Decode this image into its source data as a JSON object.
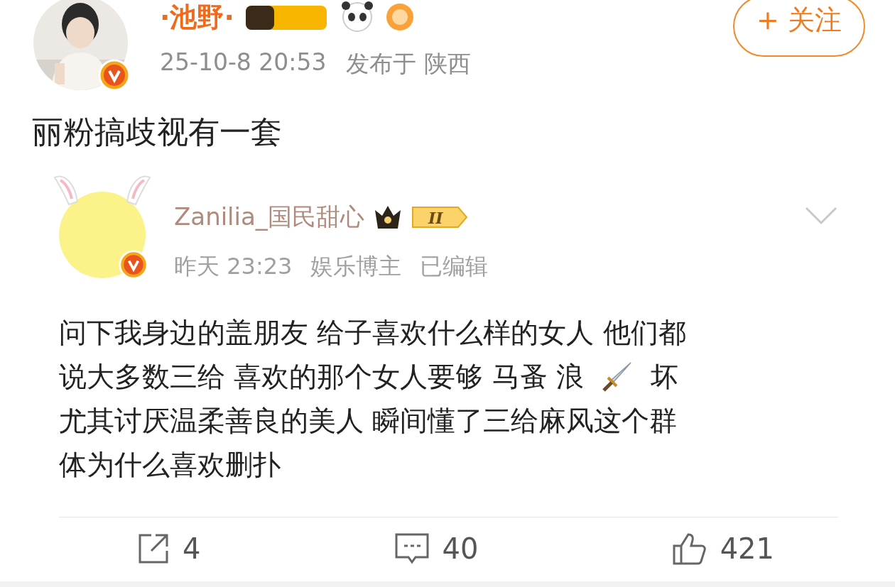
{
  "post": {
    "author": "·池野·",
    "time": "25-10-8 20:53",
    "location": "发布于 陕西",
    "follow_label": "+ 关注",
    "text": "丽粉搞歧视有一套"
  },
  "quoted": {
    "author": "Zanilia_国民甜心",
    "level": "II",
    "meta": [
      "昨天 23:23",
      "娱乐博主",
      "已编辑"
    ],
    "lines": [
      {
        "parts": [
          {
            "kind": "text",
            "text": "问下我身边的盖朋友 给子喜欢什么样的女人 他们都"
          }
        ]
      },
      {
        "parts": [
          {
            "kind": "text",
            "text": "说大多数三给 喜欢的那个女人要够 马蚤 浪"
          },
          {
            "kind": "dagger"
          },
          {
            "kind": "text",
            "text": "坏"
          }
        ]
      },
      {
        "parts": [
          {
            "kind": "text",
            "text": "尤其讨厌温柔善良的美人 瞬间懂了三给麻风这个群"
          }
        ]
      },
      {
        "parts": [
          {
            "kind": "text",
            "text": "体为什么喜欢删扑"
          }
        ]
      }
    ]
  },
  "actions": [
    {
      "kind": "repost",
      "count": "4"
    },
    {
      "kind": "comment",
      "count": "40"
    },
    {
      "kind": "like",
      "count": "421"
    }
  ]
}
